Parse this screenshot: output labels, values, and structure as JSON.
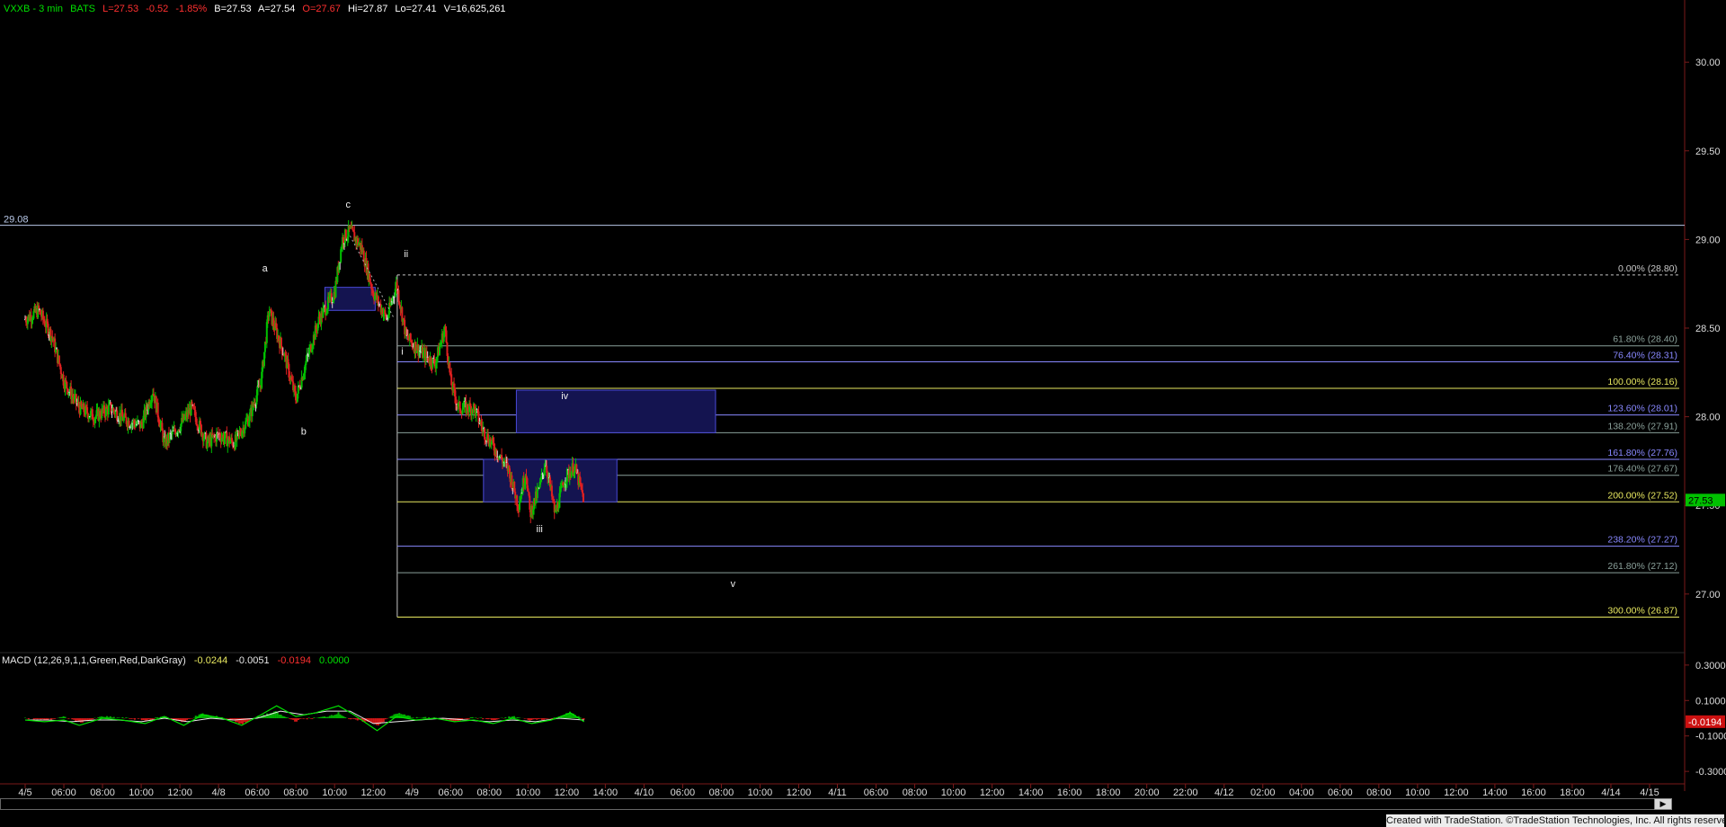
{
  "header": {
    "symbol": "VXXB - 3 min",
    "exchange": "BATS",
    "last": "L=27.53",
    "chg": "-0.52",
    "chg_pct": "-1.85%",
    "bid": "B=27.53",
    "ask": "A=27.54",
    "open": "O=27.67",
    "high": "Hi=27.87",
    "low": "Lo=27.41",
    "vol": "V=16,625,261"
  },
  "macd_header": {
    "label": "MACD (12,26,9,1,1,Green,Red,DarkGray)",
    "v1": "-0.0244",
    "v2": "-0.0051",
    "v3": "-0.0194",
    "v4": "0.0000"
  },
  "footer": "Created with TradeStation. ©TradeStation Technologies, Inc. All rights reserved.",
  "colors": {
    "background": "#000000",
    "up": "#00c000",
    "down": "#e02020",
    "doji": "#d8d8d8",
    "axis": "#7a1a1a",
    "fib_yellow": "#e8e860",
    "fib_blue": "#8888ff",
    "fib_gray": "#8aa09a",
    "box_fill": "#141450",
    "box_stroke": "#4a4ad8",
    "last_price_bg": "#00c000",
    "macd_value_bg": "#cc1010"
  },
  "chart_data": [
    {
      "type": "candlestick",
      "symbol": "VXXB",
      "interval": "3 min",
      "ylim": [
        26.7,
        30.3
      ],
      "y_ticks": [
        "30.00",
        "29.50",
        "29.00",
        "28.50",
        "28.00",
        "27.50",
        "27.00"
      ],
      "x_tick_labels": [
        "4/5",
        "06:00",
        "08:00",
        "10:00",
        "12:00",
        "4/8",
        "06:00",
        "08:00",
        "10:00",
        "12:00",
        "4/9",
        "06:00",
        "08:00",
        "10:00",
        "12:00",
        "14:00",
        "4/10",
        "06:00",
        "08:00",
        "10:00",
        "12:00",
        "4/11",
        "06:00",
        "08:00",
        "10:00",
        "12:00",
        "14:00",
        "16:00",
        "18:00",
        "20:00",
        "22:00",
        "4/12",
        "02:00",
        "04:00",
        "06:00",
        "08:00",
        "10:00",
        "12:00",
        "14:00",
        "16:00",
        "18:00",
        "4/14",
        "4/15"
      ],
      "last_price_label": "27.53",
      "last_price": 27.53,
      "reference_line": {
        "label": "29.08",
        "value": 29.08
      },
      "price_path": [
        [
          0,
          28.55
        ],
        [
          0.35,
          28.6
        ],
        [
          0.7,
          28.45
        ],
        [
          1.0,
          28.2
        ],
        [
          1.4,
          28.05
        ],
        [
          1.8,
          28.0
        ],
        [
          2.2,
          28.05
        ],
        [
          2.6,
          27.98
        ],
        [
          3.0,
          27.95
        ],
        [
          3.3,
          28.15
        ],
        [
          3.6,
          27.85
        ],
        [
          4.0,
          27.95
        ],
        [
          4.3,
          28.05
        ],
        [
          4.7,
          27.85
        ],
        [
          5.0,
          27.9
        ],
        [
          5.4,
          27.85
        ],
        [
          5.8,
          28.0
        ],
        [
          6.1,
          28.2
        ],
        [
          6.3,
          28.6
        ],
        [
          6.7,
          28.35
        ],
        [
          7.0,
          28.1
        ],
        [
          7.25,
          28.3
        ],
        [
          7.6,
          28.55
        ],
        [
          8.0,
          28.7
        ],
        [
          8.2,
          29.0
        ],
        [
          8.4,
          29.05
        ],
        [
          8.7,
          28.95
        ],
        [
          9.0,
          28.7
        ],
        [
          9.35,
          28.55
        ],
        [
          9.6,
          28.75
        ],
        [
          9.85,
          28.45
        ],
        [
          10.3,
          28.35
        ],
        [
          10.6,
          28.3
        ],
        [
          10.85,
          28.5
        ],
        [
          11.0,
          28.2
        ],
        [
          11.2,
          28.05
        ],
        [
          11.6,
          28.05
        ],
        [
          11.85,
          27.92
        ],
        [
          12.2,
          27.8
        ],
        [
          12.5,
          27.7
        ],
        [
          12.75,
          27.5
        ],
        [
          12.95,
          27.7
        ],
        [
          13.05,
          27.45
        ],
        [
          13.3,
          27.6
        ],
        [
          13.45,
          27.75
        ],
        [
          13.7,
          27.45
        ],
        [
          13.95,
          27.65
        ],
        [
          14.2,
          27.72
        ],
        [
          14.45,
          27.53
        ]
      ],
      "annotations": [
        {
          "label": "a",
          "t": 6.2,
          "price": 28.82
        },
        {
          "label": "b",
          "t": 7.2,
          "price": 27.9
        },
        {
          "label": "c",
          "t": 8.35,
          "price": 29.18
        },
        {
          "label": "i",
          "t": 9.75,
          "price": 28.35
        },
        {
          "label": "ii",
          "t": 9.85,
          "price": 28.9
        },
        {
          "label": "iii",
          "t": 13.3,
          "price": 27.35
        },
        {
          "label": "iv",
          "t": 13.95,
          "price": 28.1
        },
        {
          "label": "v",
          "t": 18.3,
          "price": 27.04
        }
      ],
      "fib_levels": [
        {
          "label": "0.00% (28.80)",
          "value": 28.8,
          "style": "dashed",
          "color": "#c8c8c8"
        },
        {
          "label": "61.80% (28.40)",
          "value": 28.4,
          "color": "#8aa09a"
        },
        {
          "label": "76.40% (28.31)",
          "value": 28.31,
          "color": "#8888ff"
        },
        {
          "label": "100.00% (28.16)",
          "value": 28.16,
          "color": "#e8e860"
        },
        {
          "label": "123.60% (28.01)",
          "value": 28.01,
          "color": "#8888ff"
        },
        {
          "label": "138.20% (27.91)",
          "value": 27.91,
          "color": "#8aa09a"
        },
        {
          "label": "161.80% (27.76)",
          "value": 27.76,
          "color": "#8888ff"
        },
        {
          "label": "176.40% (27.67)",
          "value": 27.67,
          "color": "#8aa09a"
        },
        {
          "label": "200.00% (27.52)",
          "value": 27.52,
          "color": "#e8e860"
        },
        {
          "label": "238.20% (27.27)",
          "value": 27.27,
          "color": "#8888ff"
        },
        {
          "label": "261.80% (27.12)",
          "value": 27.12,
          "color": "#8aa09a"
        },
        {
          "label": "300.00% (26.87)",
          "value": 26.87,
          "color": "#e8e860"
        }
      ],
      "target_boxes": [
        {
          "name": "wave-c-box",
          "t0": 7.75,
          "t1": 9.05,
          "price_top": 28.73,
          "price_bottom": 28.6
        },
        {
          "name": "wave-iv-box",
          "t0": 12.7,
          "t1": 17.85,
          "price_top": 28.15,
          "price_bottom": 27.91
        },
        {
          "name": "wave-iii-box",
          "t0": 11.85,
          "t1": 15.3,
          "price_top": 27.76,
          "price_bottom": 27.52
        }
      ]
    },
    {
      "type": "line",
      "indicator": "MACD",
      "ylim": [
        -0.35,
        0.35
      ],
      "y_ticks": [
        "0.3000",
        "0.1000",
        "-0.1000",
        "-0.3000"
      ],
      "value_label": "-0.0194",
      "macd_path": [
        [
          0,
          -0.01
        ],
        [
          0.5,
          -0.02
        ],
        [
          1.0,
          -0.01
        ],
        [
          1.4,
          -0.04
        ],
        [
          2.0,
          0.0
        ],
        [
          2.5,
          -0.01
        ],
        [
          3.1,
          -0.03
        ],
        [
          3.6,
          0.01
        ],
        [
          4.1,
          -0.04
        ],
        [
          4.6,
          0.02
        ],
        [
          5.1,
          0.0
        ],
        [
          5.6,
          -0.04
        ],
        [
          6.1,
          0.02
        ],
        [
          6.5,
          0.07
        ],
        [
          7.0,
          0.01
        ],
        [
          7.5,
          0.03
        ],
        [
          8.1,
          0.07
        ],
        [
          8.5,
          0.02
        ],
        [
          9.1,
          -0.07
        ],
        [
          9.6,
          0.01
        ],
        [
          10.1,
          -0.01
        ],
        [
          10.6,
          0.0
        ],
        [
          11.1,
          -0.02
        ],
        [
          11.6,
          -0.01
        ],
        [
          12.1,
          -0.03
        ],
        [
          12.6,
          0.0
        ],
        [
          13.1,
          -0.03
        ],
        [
          13.6,
          -0.01
        ],
        [
          14.1,
          0.03
        ],
        [
          14.45,
          -0.02
        ]
      ],
      "signal_path": [
        [
          0,
          -0.01
        ],
        [
          0.6,
          -0.01
        ],
        [
          1.2,
          -0.02
        ],
        [
          1.8,
          -0.01
        ],
        [
          2.4,
          -0.01
        ],
        [
          3.0,
          -0.02
        ],
        [
          3.6,
          0.0
        ],
        [
          4.2,
          -0.02
        ],
        [
          4.8,
          0.0
        ],
        [
          5.4,
          -0.01
        ],
        [
          6.0,
          0.0
        ],
        [
          6.6,
          0.04
        ],
        [
          7.2,
          0.02
        ],
        [
          7.8,
          0.04
        ],
        [
          8.4,
          0.04
        ],
        [
          9.0,
          -0.03
        ],
        [
          9.6,
          -0.02
        ],
        [
          10.2,
          -0.01
        ],
        [
          10.8,
          0.0
        ],
        [
          11.4,
          -0.01
        ],
        [
          12.0,
          -0.02
        ],
        [
          12.6,
          -0.01
        ],
        [
          13.2,
          -0.02
        ],
        [
          13.8,
          0.0
        ],
        [
          14.45,
          -0.01
        ]
      ]
    }
  ]
}
